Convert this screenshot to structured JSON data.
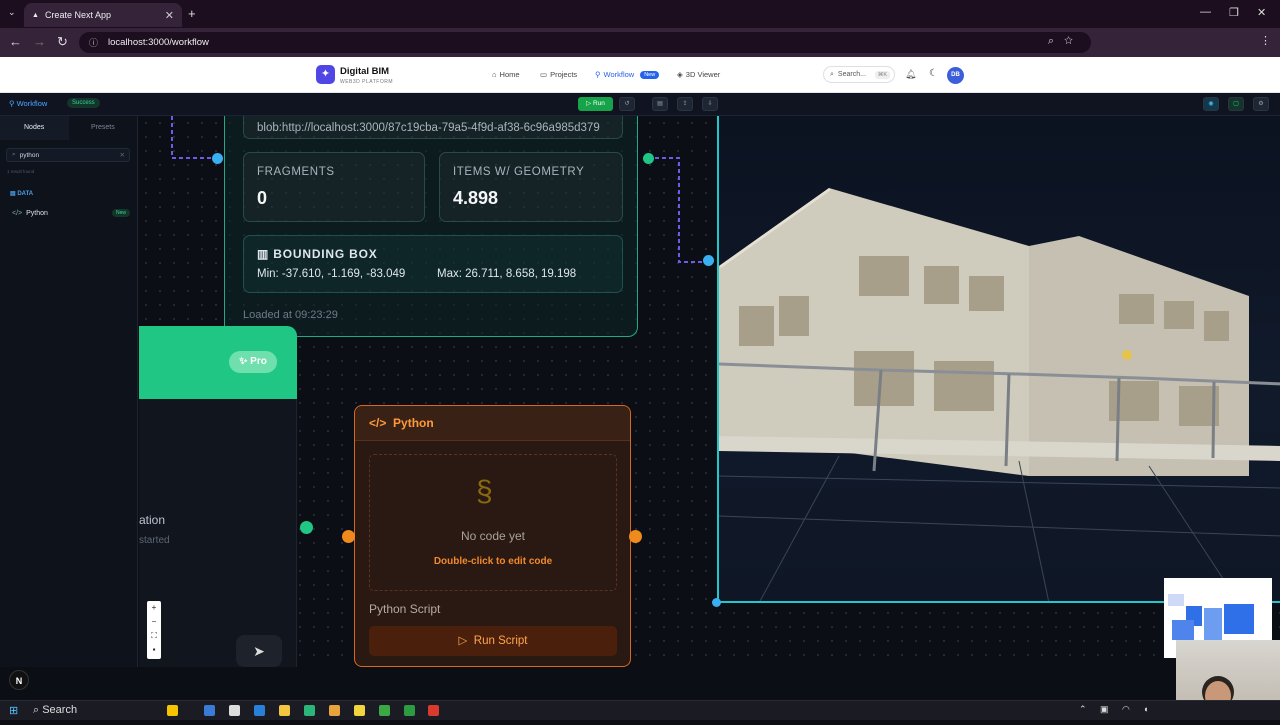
{
  "browser": {
    "tab_title": "Create Next App",
    "new_tab": "+",
    "url": "localhost:3000/workflow"
  },
  "app": {
    "brand": "Digital BIM",
    "brand_sub": "WEB3D PLATFORM",
    "nav": [
      {
        "label": "Home",
        "icon": "home-icon"
      },
      {
        "label": "Projects",
        "icon": "folder-icon"
      },
      {
        "label": "Workflow",
        "icon": "workflow-icon",
        "badge": "New"
      },
      {
        "label": "3D Viewer",
        "icon": "cube-icon"
      }
    ],
    "search_placeholder": "Search...",
    "search_kbd": "⌘K",
    "avatar_initials": "DB",
    "accent": "#2563eb"
  },
  "toolbar": {
    "title": "Workflow",
    "status": "Success",
    "run_label": "Run"
  },
  "sidebar": {
    "tabs": [
      "Nodes",
      "Presets"
    ],
    "search_value": "python",
    "result_count": "1 result found",
    "category": "DATA",
    "item": {
      "label": "Python",
      "badge": "New"
    }
  },
  "ifc_node": {
    "blob_url": "blob:http://localhost:3000/87c19cba-79a5-4f9d-af38-6c96a985d379",
    "fragments_label": "FRAGMENTS",
    "fragments_value": "0",
    "items_label": "ITEMS W/ GEOMETRY",
    "items_value": "4.898",
    "bbox_title": "BOUNDING BOX",
    "bbox_min": "Min: -37.610, -1.169, -83.049",
    "bbox_max": "Max: 26.711, 8.658, 19.198",
    "loaded_at": "Loaded at 09:23:29"
  },
  "pro_node": {
    "badge": "Pro"
  },
  "chat_node": {
    "title_fragment": "ation",
    "subtitle_fragment": "started"
  },
  "python_node": {
    "title": "Python",
    "empty_text": "No code yet",
    "hint": "Double-click to edit code",
    "script_label": "Python Script",
    "run_label": "Run Script"
  },
  "taskbar": {
    "search_label": "Search"
  },
  "colors": {
    "success": "#38d39f",
    "python_accent": "#d9681f",
    "viewer_border": "#23c7c7"
  }
}
